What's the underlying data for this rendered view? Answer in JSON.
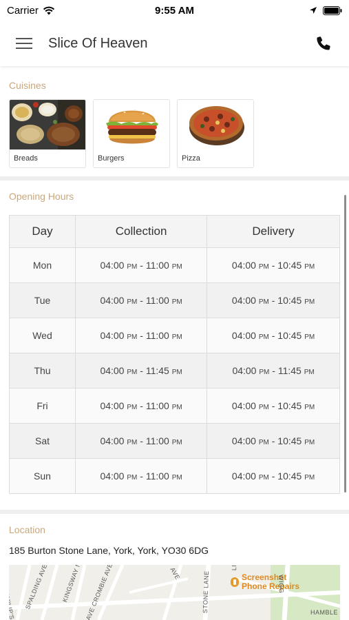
{
  "status_bar": {
    "carrier": "Carrier",
    "time": "9:55 AM"
  },
  "header": {
    "title": "Slice Of Heaven",
    "menu_icon": "hamburger-menu-icon",
    "phone_icon": "phone-icon"
  },
  "cuisines": {
    "label": "Cuisines",
    "items": [
      {
        "name": "Breads"
      },
      {
        "name": "Burgers"
      },
      {
        "name": "Pizza"
      }
    ]
  },
  "opening_hours": {
    "label": "Opening Hours",
    "columns": [
      "Day",
      "Collection",
      "Delivery"
    ],
    "rows": [
      {
        "day": "Mon",
        "c_from": "04:00",
        "c_from_ampm": "PM",
        "c_to": "11:00",
        "c_to_ampm": "PM",
        "d_from": "04:00",
        "d_from_ampm": "PM",
        "d_to": "10:45",
        "d_to_ampm": "PM"
      },
      {
        "day": "Tue",
        "c_from": "04:00",
        "c_from_ampm": "PM",
        "c_to": "11:00",
        "c_to_ampm": "PM",
        "d_from": "04:00",
        "d_from_ampm": "PM",
        "d_to": "10:45",
        "d_to_ampm": "PM"
      },
      {
        "day": "Wed",
        "c_from": "04:00",
        "c_from_ampm": "PM",
        "c_to": "11:00",
        "c_to_ampm": "PM",
        "d_from": "04:00",
        "d_from_ampm": "PM",
        "d_to": "10:45",
        "d_to_ampm": "PM"
      },
      {
        "day": "Thu",
        "c_from": "04:00",
        "c_from_ampm": "PM",
        "c_to": "11:45",
        "c_to_ampm": "PM",
        "d_from": "04:00",
        "d_from_ampm": "PM",
        "d_to": "11:45",
        "d_to_ampm": "PM"
      },
      {
        "day": "Fri",
        "c_from": "04:00",
        "c_from_ampm": "PM",
        "c_to": "11:00",
        "c_to_ampm": "PM",
        "d_from": "04:00",
        "d_from_ampm": "PM",
        "d_to": "10:45",
        "d_to_ampm": "PM"
      },
      {
        "day": "Sat",
        "c_from": "04:00",
        "c_from_ampm": "PM",
        "c_to": "11:00",
        "c_to_ampm": "PM",
        "d_from": "04:00",
        "d_from_ampm": "PM",
        "d_to": "10:45",
        "d_to_ampm": "PM"
      },
      {
        "day": "Sun",
        "c_from": "04:00",
        "c_from_ampm": "PM",
        "c_to": "11:00",
        "c_to_ampm": "PM",
        "d_from": "04:00",
        "d_from_ampm": "PM",
        "d_to": "10:45",
        "d_to_ampm": "PM"
      }
    ]
  },
  "location": {
    "label": "Location",
    "address": "185 Burton Stone Lane, York, York, YO30 6DG",
    "map": {
      "streets": [
        "ST PHILIP'S GRO",
        "SPALDING AVE",
        "KINGSWAY N",
        "AVE CROMBIE AVE",
        "AVE",
        "STONE LANE",
        "LI",
        "WIGG",
        "HAMBLE"
      ],
      "poi": "Screenshot Phone Repairs"
    }
  },
  "colors": {
    "section_label": "#c9a77c",
    "poi": "#e08a24",
    "divider": "#eeeeee"
  }
}
